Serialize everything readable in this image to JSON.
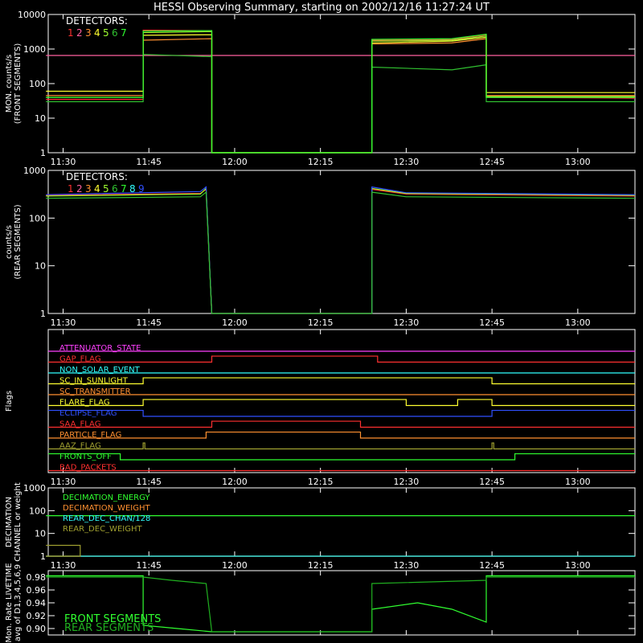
{
  "title": "HESSI Observing Summary, starting on 2002/12/16 11:27:24 UT",
  "time_ticks": [
    "11:30",
    "11:45",
    "12:00",
    "12:15",
    "12:30",
    "12:45",
    "13:00"
  ],
  "colors": {
    "background": "#000000",
    "axes": "#ffffff",
    "det1": "#ff3030",
    "det2": "#ff60a0",
    "det3": "#ff9030",
    "det4": "#ffff30",
    "det5": "#a0ff30",
    "det6": "#30c030",
    "det7": "#30ff30",
    "det8": "#30ffff",
    "det9": "#3050ff"
  },
  "chart_data": [
    {
      "type": "line",
      "panel": "front",
      "ylabel": "MON. counts/s\n(FRONT SEGMENTS)",
      "y_scale": "log",
      "ylim": [
        1,
        10000
      ],
      "y_ticks": [
        "1",
        "10",
        "100",
        "1000",
        "10000"
      ],
      "x_range": [
        "11:27:24",
        "13:10:00"
      ],
      "legend_title": "DETECTORS:",
      "legend_items": [
        "1",
        "2",
        "3",
        "4",
        "5",
        "6",
        "7"
      ],
      "series": [
        {
          "name": "1",
          "points": [
            [
              "11:27",
              35
            ],
            [
              "11:44",
              35
            ],
            [
              "11:44",
              3500
            ],
            [
              "11:56",
              3400
            ],
            [
              "11:56",
              1
            ],
            [
              "12:24",
              1
            ],
            [
              "12:24",
              1800
            ],
            [
              "12:38",
              1900
            ],
            [
              "12:44",
              2600
            ],
            [
              "12:44",
              40
            ],
            [
              "13:10",
              38
            ]
          ]
        },
        {
          "name": "2",
          "points": [
            [
              "11:27",
              650
            ],
            [
              "13:10",
              650
            ]
          ]
        },
        {
          "name": "3",
          "points": [
            [
              "11:27",
              45
            ],
            [
              "11:44",
              45
            ],
            [
              "11:44",
              1800
            ],
            [
              "11:56",
              2000
            ],
            [
              "11:56",
              1
            ],
            [
              "12:24",
              1
            ],
            [
              "12:24",
              1400
            ],
            [
              "12:38",
              1500
            ],
            [
              "12:44",
              2000
            ],
            [
              "12:44",
              45
            ],
            [
              "13:10",
              45
            ]
          ]
        },
        {
          "name": "4",
          "points": [
            [
              "11:27",
              60
            ],
            [
              "11:44",
              60
            ],
            [
              "11:44",
              2500
            ],
            [
              "11:56",
              2600
            ],
            [
              "11:56",
              1
            ],
            [
              "12:24",
              1
            ],
            [
              "12:24",
              1500
            ],
            [
              "12:38",
              1700
            ],
            [
              "12:44",
              2200
            ],
            [
              "12:44",
              55
            ],
            [
              "13:10",
              55
            ]
          ]
        },
        {
          "name": "5",
          "points": [
            [
              "11:27",
              40
            ],
            [
              "11:44",
              40
            ],
            [
              "11:44",
              3000
            ],
            [
              "11:56",
              3200
            ],
            [
              "11:56",
              1
            ],
            [
              "12:24",
              1
            ],
            [
              "12:24",
              1700
            ],
            [
              "12:38",
              1800
            ],
            [
              "12:44",
              2400
            ],
            [
              "12:44",
              42
            ],
            [
              "13:10",
              42
            ]
          ]
        },
        {
          "name": "6",
          "points": [
            [
              "11:27",
              30
            ],
            [
              "11:44",
              30
            ],
            [
              "11:44",
              700
            ],
            [
              "11:56",
              600
            ],
            [
              "11:56",
              1
            ],
            [
              "12:24",
              1
            ],
            [
              "12:24",
              300
            ],
            [
              "12:38",
              250
            ],
            [
              "12:44",
              350
            ],
            [
              "12:44",
              30
            ],
            [
              "13:10",
              30
            ]
          ]
        },
        {
          "name": "7",
          "points": [
            [
              "11:27",
              40
            ],
            [
              "11:44",
              40
            ],
            [
              "11:44",
              3300
            ],
            [
              "11:56",
              3400
            ],
            [
              "11:56",
              1
            ],
            [
              "12:24",
              1
            ],
            [
              "12:24",
              1900
            ],
            [
              "12:38",
              2000
            ],
            [
              "12:44",
              2700
            ],
            [
              "12:44",
              40
            ],
            [
              "13:10",
              40
            ]
          ]
        }
      ]
    },
    {
      "type": "line",
      "panel": "rear",
      "ylabel": "counts/s\n(REAR SEGMENTS)",
      "y_scale": "log",
      "ylim": [
        1,
        1000
      ],
      "y_ticks": [
        "1",
        "10",
        "100",
        "1000"
      ],
      "x_range": [
        "11:27:24",
        "13:10:00"
      ],
      "legend_title": "DETECTORS:",
      "legend_items": [
        "1",
        "2",
        "3",
        "4",
        "5",
        "6",
        "7",
        "8",
        "9"
      ],
      "series": [
        {
          "name": "1",
          "points": [
            [
              "11:27",
              300
            ],
            [
              "11:54",
              330
            ],
            [
              "11:55",
              400
            ],
            [
              "11:56",
              1
            ],
            [
              "12:24",
              1
            ],
            [
              "12:24",
              400
            ],
            [
              "12:30",
              320
            ],
            [
              "13:10",
              290
            ]
          ]
        },
        {
          "name": "5",
          "points": [
            [
              "11:27",
              290
            ],
            [
              "11:54",
              320
            ],
            [
              "11:55",
              420
            ],
            [
              "11:56",
              1
            ],
            [
              "12:24",
              1
            ],
            [
              "12:24",
              420
            ],
            [
              "12:30",
              330
            ],
            [
              "13:10",
              300
            ]
          ]
        },
        {
          "name": "9",
          "points": [
            [
              "11:27",
              310
            ],
            [
              "11:54",
              360
            ],
            [
              "11:55",
              450
            ],
            [
              "11:56",
              1
            ],
            [
              "12:24",
              1
            ],
            [
              "12:24",
              450
            ],
            [
              "12:30",
              340
            ],
            [
              "13:10",
              310
            ]
          ]
        },
        {
          "name": "6",
          "points": [
            [
              "11:27",
              260
            ],
            [
              "11:54",
              280
            ],
            [
              "11:55",
              350
            ],
            [
              "11:56",
              1
            ],
            [
              "12:24",
              1
            ],
            [
              "12:24",
              350
            ],
            [
              "12:30",
              280
            ],
            [
              "13:10",
              260
            ]
          ]
        }
      ]
    },
    {
      "type": "line",
      "panel": "flags",
      "ylabel": "Flags",
      "flags": [
        {
          "name": "ATTENUATOR_STATE",
          "color": "#ff40ff",
          "steps": [
            [
              "11:27",
              0
            ]
          ]
        },
        {
          "name": "GAP_FLAG",
          "color": "#ff3030",
          "steps": [
            [
              "11:27",
              0
            ],
            [
              "11:56",
              1
            ],
            [
              "12:25",
              0
            ]
          ]
        },
        {
          "name": "NON_SOLAR_EVENT",
          "color": "#30ffff",
          "steps": [
            [
              "11:27",
              0
            ]
          ]
        },
        {
          "name": "SC_IN_SUNLIGHT",
          "color": "#ffff30",
          "steps": [
            [
              "11:27",
              0
            ],
            [
              "11:44",
              1
            ],
            [
              "12:45",
              0
            ]
          ]
        },
        {
          "name": "SC_TRANSMITTER",
          "color": "#ff9030",
          "steps": [
            [
              "11:27",
              0
            ]
          ]
        },
        {
          "name": "FLARE_FLAG",
          "color": "#ffff30",
          "steps": [
            [
              "11:27",
              0
            ],
            [
              "11:44",
              1
            ],
            [
              "12:30",
              0
            ],
            [
              "12:39",
              1
            ],
            [
              "12:45",
              0
            ]
          ]
        },
        {
          "name": "ECLIPSE_FLAG",
          "color": "#3050ff",
          "steps": [
            [
              "11:27",
              1
            ],
            [
              "11:44",
              0
            ],
            [
              "12:45",
              1
            ]
          ]
        },
        {
          "name": "SAA_FLAG",
          "color": "#ff3030",
          "steps": [
            [
              "11:27",
              0
            ],
            [
              "11:56",
              1
            ],
            [
              "12:22",
              0
            ]
          ]
        },
        {
          "name": "PARTICLE_FLAG",
          "color": "#ff9030",
          "steps": [
            [
              "11:27",
              0
            ],
            [
              "11:55",
              1
            ],
            [
              "12:22",
              0
            ]
          ]
        },
        {
          "name": "AAZ_FLAG",
          "color": "#a0a030",
          "steps": [
            [
              "11:27",
              0
            ],
            [
              "11:44",
              1
            ],
            [
              "11:44.3",
              0
            ],
            [
              "12:45",
              1
            ],
            [
              "12:45.3",
              0
            ]
          ]
        },
        {
          "name": "FRONTS_OFF",
          "color": "#30ff30",
          "steps": [
            [
              "11:27",
              1
            ],
            [
              "11:40",
              0
            ],
            [
              "12:49",
              1
            ]
          ]
        },
        {
          "name": "BAD_PACKETS",
          "color": "#ff3030",
          "steps": [
            [
              "11:27",
              0
            ]
          ]
        }
      ]
    },
    {
      "type": "line",
      "panel": "decimation",
      "ylabel": "DECIMATION\nCHANNEL or weight",
      "y_scale": "log",
      "ylim": [
        1,
        1000
      ],
      "y_ticks": [
        "1",
        "10",
        "100",
        "1000"
      ],
      "series": [
        {
          "name": "DECIMATION_ENERGY",
          "color": "#30ff30",
          "points": [
            [
              "11:27",
              60
            ],
            [
              "13:10",
              60
            ]
          ]
        },
        {
          "name": "DECIMATION_WEIGHT",
          "color": "#ff9030",
          "points": [
            [
              "11:27",
              1
            ],
            [
              "13:10",
              1
            ]
          ]
        },
        {
          "name": "REAR_DEC_CHAN/128",
          "color": "#30ffff",
          "points": [
            [
              "11:27",
              1
            ],
            [
              "13:10",
              1
            ]
          ]
        },
        {
          "name": "REAR_DEC_WEIGHT",
          "color": "#a0a030",
          "points": [
            [
              "11:27",
              1
            ],
            [
              "11:33",
              1
            ],
            [
              "11:33",
              3
            ],
            [
              "11:27",
              3
            ]
          ]
        }
      ]
    },
    {
      "type": "line",
      "panel": "livetime",
      "ylabel": "Mon. Rate LIVETIME\navg of D1,3,4,5,6,9",
      "ylim": [
        0.89,
        0.99
      ],
      "y_ticks": [
        "0.90",
        "0.92",
        "0.94",
        "0.96",
        "0.98"
      ],
      "legend_items": [
        "FRONT SEGMENTS",
        "REAR SEGMENTS"
      ],
      "series": [
        {
          "name": "FRONT SEGMENTS",
          "color": "#30ff30",
          "points": [
            [
              "11:27",
              0.982
            ],
            [
              "11:44",
              0.982
            ],
            [
              "11:44",
              0.905
            ],
            [
              "11:50",
              0.9
            ],
            [
              "11:56",
              0.895
            ],
            [
              "12:24",
              0.895
            ],
            [
              "12:24",
              0.93
            ],
            [
              "12:32",
              0.94
            ],
            [
              "12:38",
              0.93
            ],
            [
              "12:44",
              0.91
            ],
            [
              "12:44",
              0.982
            ],
            [
              "13:10",
              0.982
            ]
          ]
        },
        {
          "name": "REAR SEGMENTS",
          "color": "#20b020",
          "points": [
            [
              "11:27",
              0.98
            ],
            [
              "11:44",
              0.98
            ],
            [
              "11:49",
              0.975
            ],
            [
              "11:55",
              0.97
            ],
            [
              "11:56",
              0.895
            ],
            [
              "12:24",
              0.895
            ],
            [
              "12:24",
              0.97
            ],
            [
              "12:44",
              0.975
            ],
            [
              "12:44",
              0.98
            ],
            [
              "13:10",
              0.98
            ]
          ]
        }
      ]
    }
  ]
}
